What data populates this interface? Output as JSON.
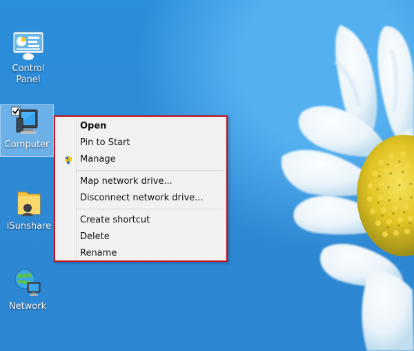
{
  "desktop": {
    "icons": [
      {
        "label": "Control\nPanel",
        "icon": "control-panel-icon"
      },
      {
        "label": "Computer",
        "icon": "computer-icon"
      },
      {
        "label": "iSunshare",
        "icon": "user-folder-icon"
      },
      {
        "label": "Network",
        "icon": "network-icon"
      }
    ]
  },
  "context_menu": {
    "items": [
      {
        "label": "Open",
        "bold": true
      },
      {
        "label": "Pin to Start"
      },
      {
        "label": "Manage",
        "icon": "shield-icon"
      },
      {
        "label": "Map network drive..."
      },
      {
        "label": "Disconnect network drive..."
      },
      {
        "label": "Create shortcut"
      },
      {
        "label": "Delete"
      },
      {
        "label": "Rename"
      }
    ]
  },
  "colors": {
    "menu_border": "#c0101d",
    "wallpaper_blue": "#2f8fd7",
    "flower_center": "#e0c323"
  }
}
